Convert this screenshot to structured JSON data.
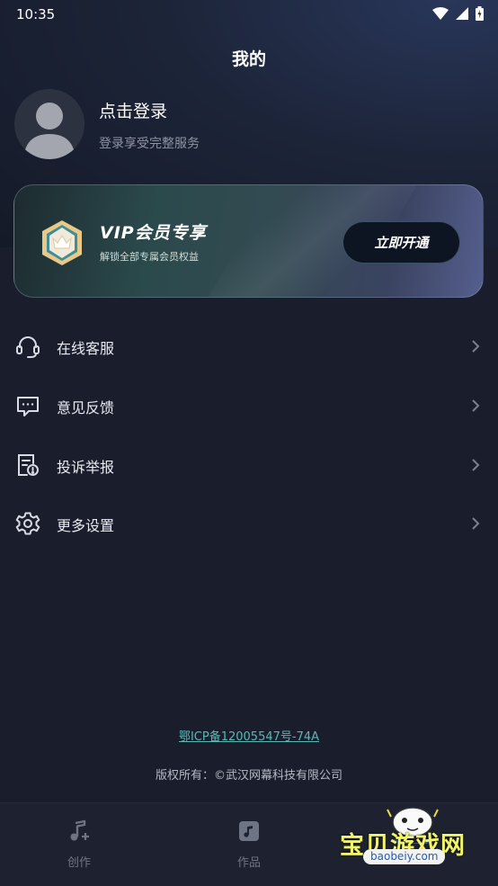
{
  "status_bar": {
    "time": "10:35"
  },
  "header": {
    "title": "我的"
  },
  "profile": {
    "login_title": "点击登录",
    "login_subtitle": "登录享受完整服务"
  },
  "vip": {
    "title": "VIP会员专享",
    "subtitle": "解锁全部专属会员权益",
    "button_label": "立即开通"
  },
  "menu": [
    {
      "label": "在线客服",
      "icon": "headset-icon"
    },
    {
      "label": "意见反馈",
      "icon": "chat-feedback-icon"
    },
    {
      "label": "投诉举报",
      "icon": "report-document-icon"
    },
    {
      "label": "更多设置",
      "icon": "gear-icon"
    }
  ],
  "footer": {
    "icp": "鄂ICP备12005547号-74A",
    "copyright": "版权所有：©武汉网幕科技有限公司"
  },
  "tab_bar": [
    {
      "label": "创作",
      "icon": "music-note-icon"
    },
    {
      "label": "作品",
      "icon": "music-square-icon"
    }
  ],
  "watermark": {
    "text": "宝贝游戏网",
    "url": "baobeiy.com"
  },
  "colors": {
    "background": "#1a1e2c",
    "icp_link": "#5ab8b5",
    "watermark_text": "#f1f36a"
  }
}
